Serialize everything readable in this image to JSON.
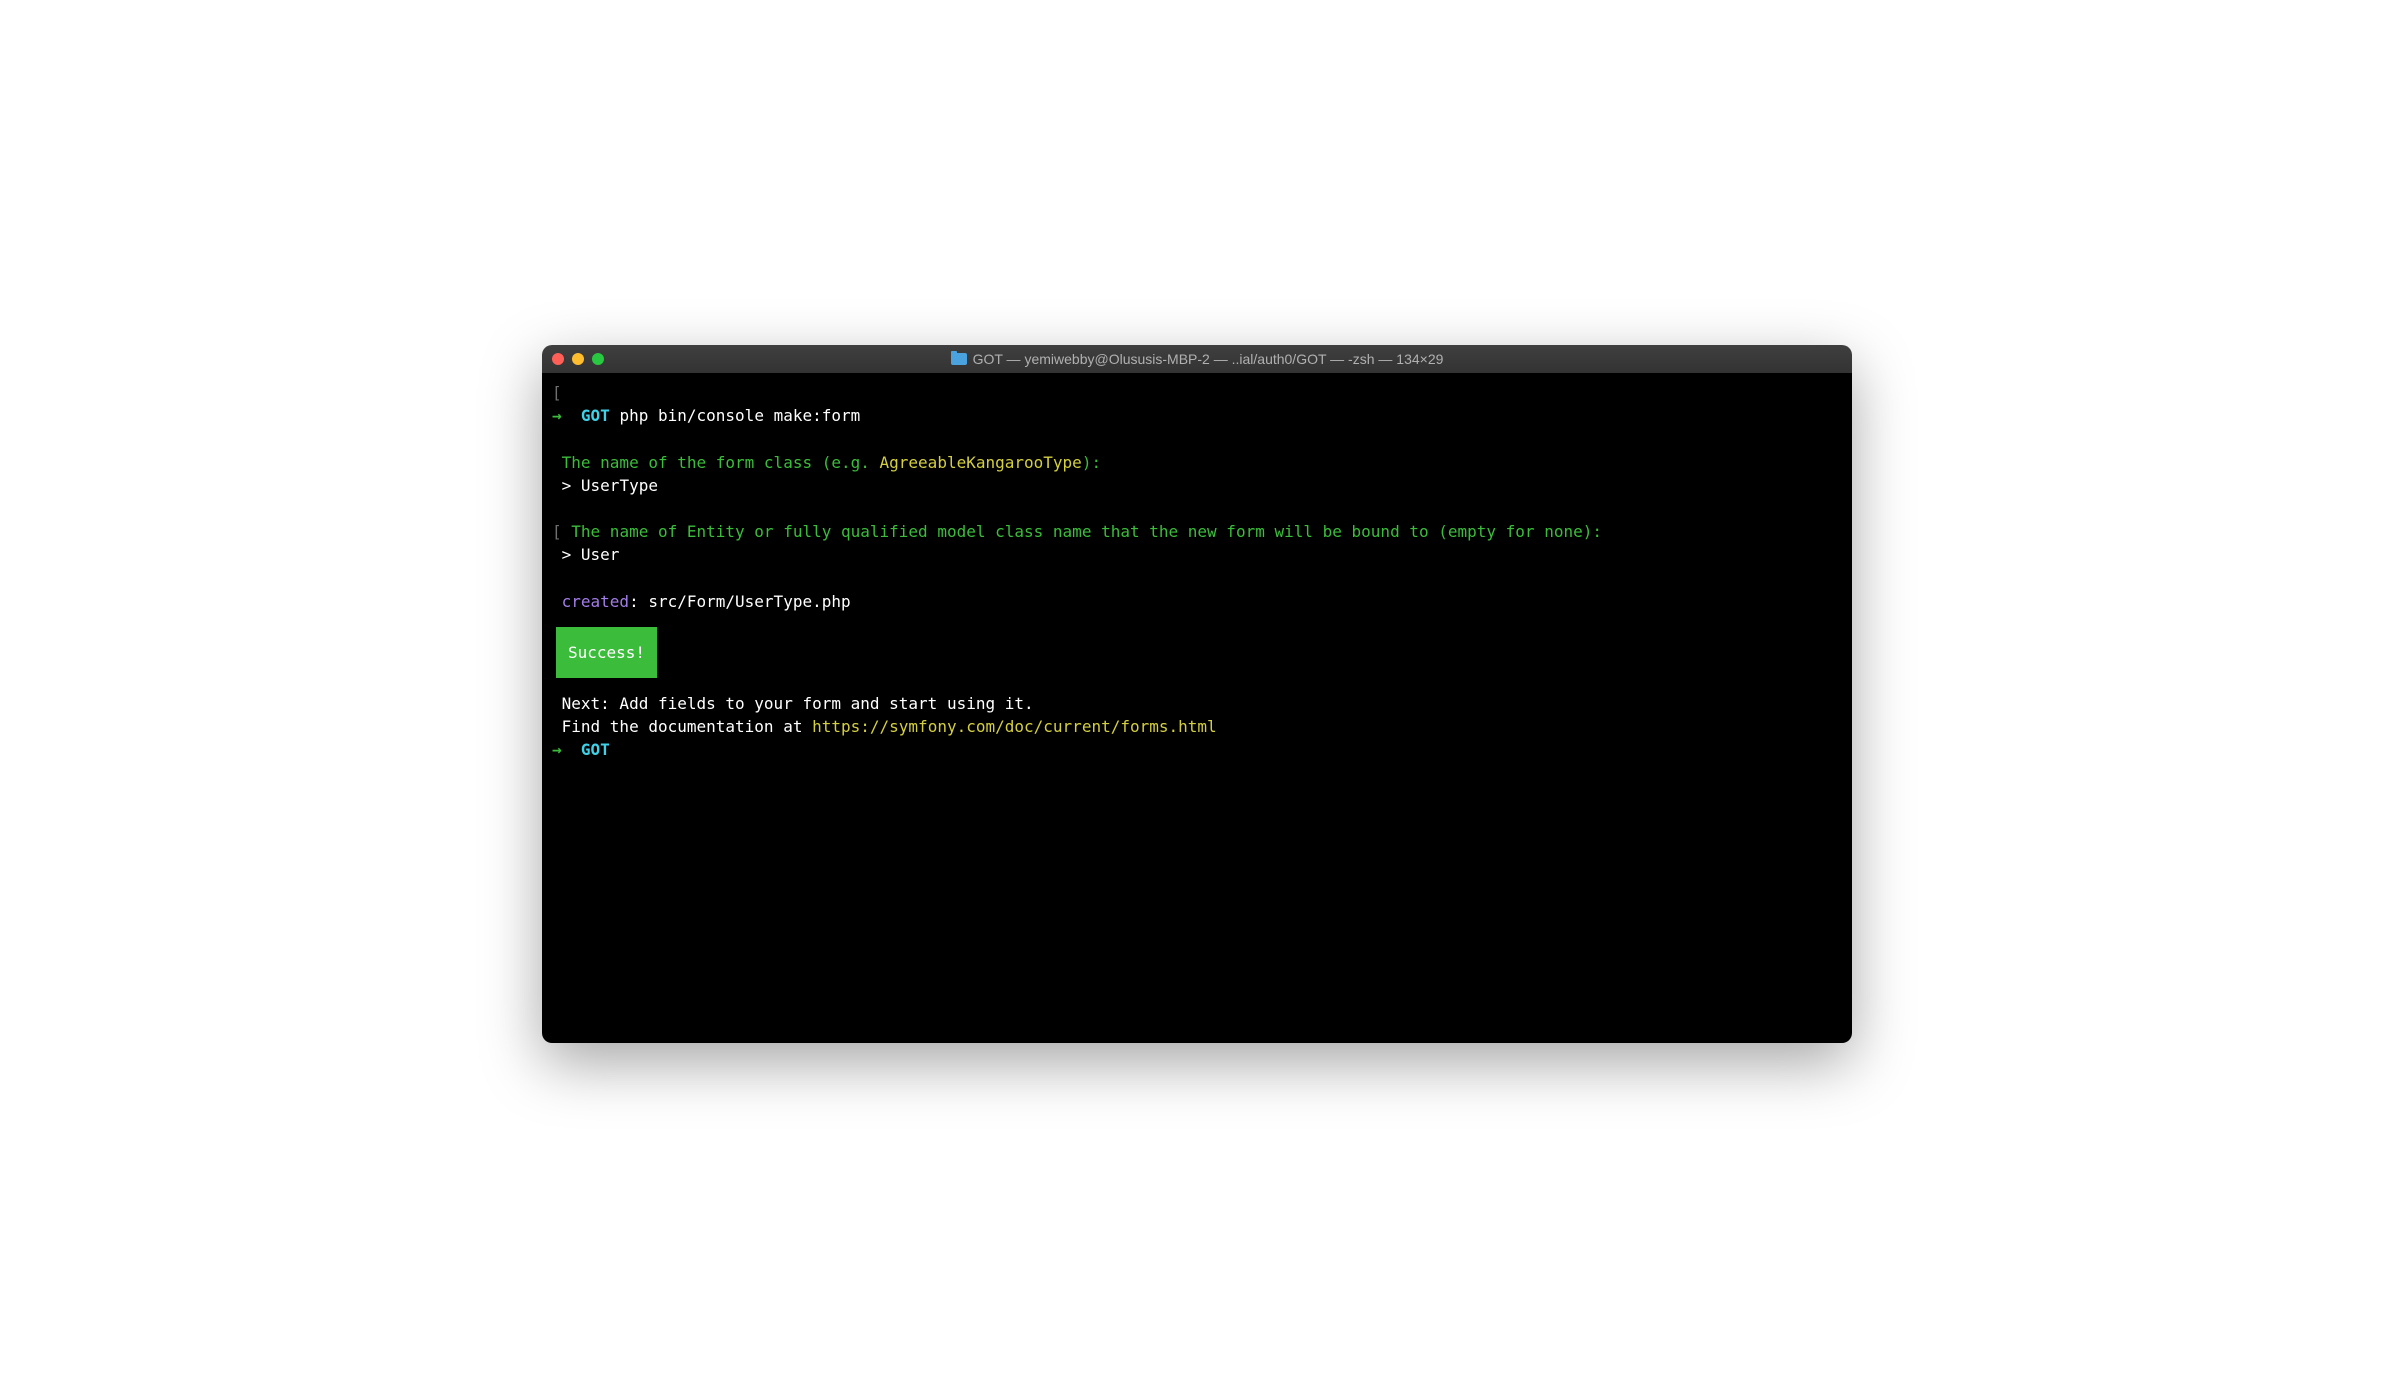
{
  "titlebar": {
    "title": "GOT — yemiwebby@Olususis-MBP-2 — ..ial/auth0/GOT — -zsh — 134×29"
  },
  "prompt1": {
    "arrow": "→",
    "cwd": "GOT",
    "command": "php bin/console make:form"
  },
  "question1": {
    "prefix": " The name of the form class (e.g. ",
    "example": "AgreeableKangarooType",
    "suffix": "):"
  },
  "answer1": {
    "prompt": " > ",
    "value": "UserType"
  },
  "question2": {
    "text": " The name of Entity or fully qualified model class name that the new form will be bound to (empty for none):"
  },
  "answer2": {
    "prompt": " > ",
    "value": "User"
  },
  "created": {
    "label": " created",
    "sep": ": ",
    "path": "src/Form/UserType.php"
  },
  "success": {
    "text": "Success!"
  },
  "next": {
    "line1": " Next: Add fields to your form and start using it.",
    "line2_prefix": " Find the documentation at ",
    "line2_link": "https://symfony.com/doc/current/forms.html"
  },
  "prompt2": {
    "arrow": "→",
    "cwd": "GOT"
  }
}
